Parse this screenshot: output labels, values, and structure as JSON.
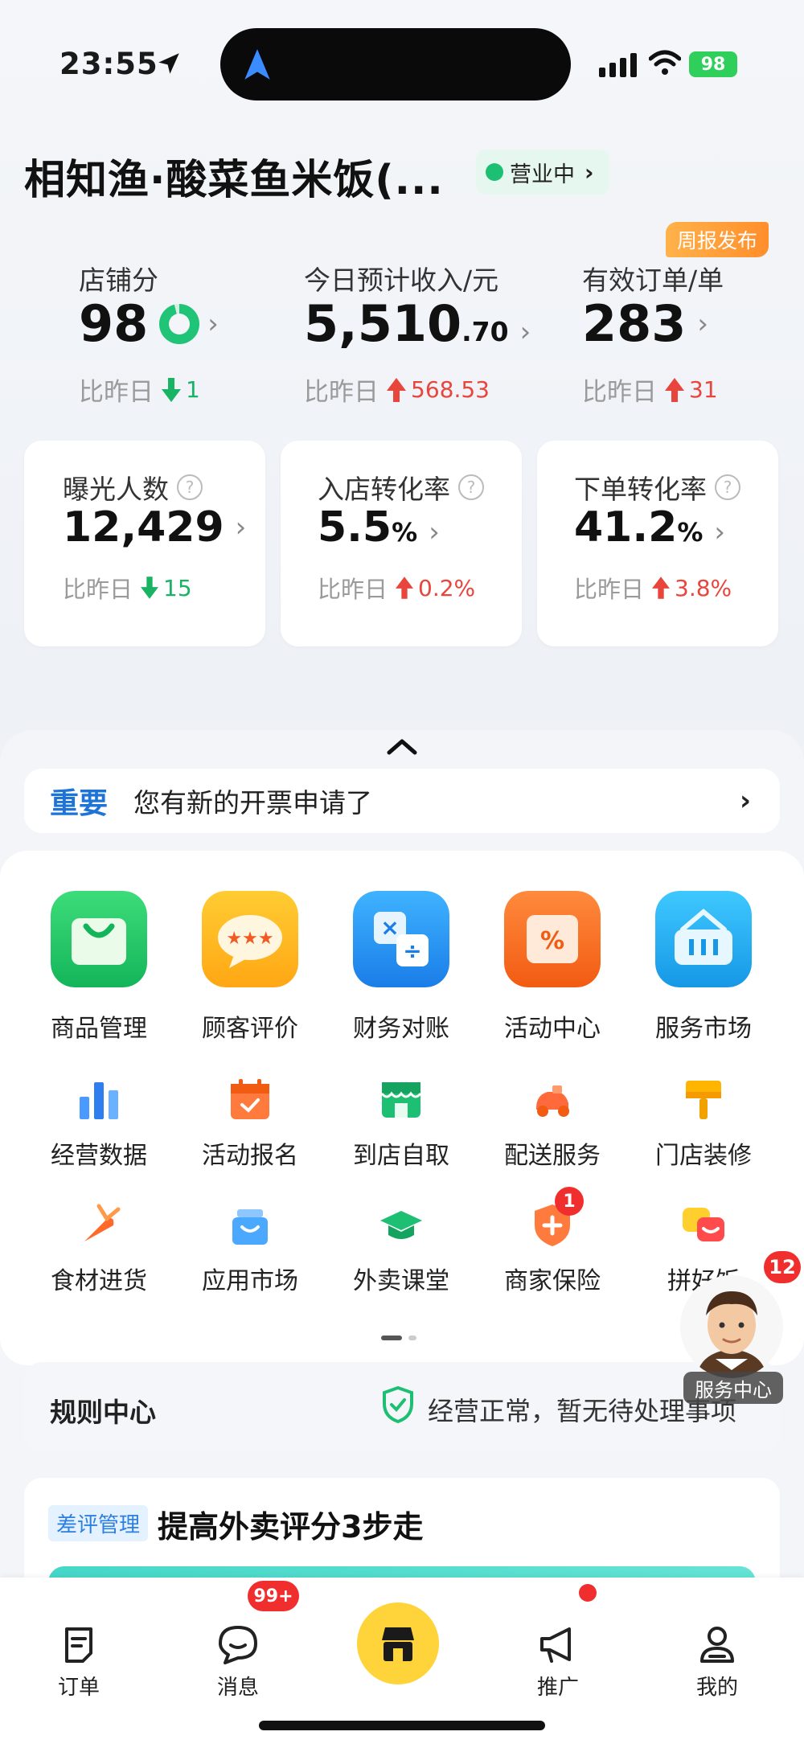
{
  "status_bar": {
    "time": "23:55",
    "battery": "98"
  },
  "header": {
    "store_name": "相知渔·酸菜鱼米饭(...",
    "status": "营业中",
    "weekly_report": "周报发布"
  },
  "kpis": [
    {
      "label": "店铺分",
      "value": "98",
      "decimal": "",
      "compare_label": "比昨日",
      "delta": "1",
      "direction": "down"
    },
    {
      "label": "今日预计收入/元",
      "value": "5,510",
      "decimal": ".70",
      "compare_label": "比昨日",
      "delta": "568.53",
      "direction": "up"
    },
    {
      "label": "有效订单/单",
      "value": "283",
      "decimal": "",
      "compare_label": "比昨日",
      "delta": "31",
      "direction": "up"
    }
  ],
  "metrics": [
    {
      "label": "曝光人数",
      "value": "12,429",
      "unit": "",
      "compare_label": "比昨日",
      "delta": "15",
      "direction": "down"
    },
    {
      "label": "入店转化率",
      "value": "5.5",
      "unit": "%",
      "compare_label": "比昨日",
      "delta": "0.2%",
      "direction": "up"
    },
    {
      "label": "下单转化率",
      "value": "41.2",
      "unit": "%",
      "compare_label": "比昨日",
      "delta": "3.8%",
      "direction": "up"
    }
  ],
  "notice": {
    "tag": "重要",
    "message": "您有新的开票申请了"
  },
  "apps_row1": [
    "商品管理",
    "顾客评价",
    "财务对账",
    "活动中心",
    "服务市场"
  ],
  "apps_row2": [
    "经营数据",
    "活动报名",
    "到店自取",
    "配送服务",
    "门店装修"
  ],
  "apps_row3": [
    "食材进货",
    "应用市场",
    "外卖课堂",
    "商家保险",
    "拼好饭"
  ],
  "app_badges": {
    "insurance": "1",
    "avatar": "12"
  },
  "rules": {
    "title": "规则中心",
    "status": "经营正常，暂无待处理事项"
  },
  "tip": {
    "tag": "差评管理",
    "title": "提高外卖评分3步走"
  },
  "avatar_label": "服务中心",
  "tabbar": {
    "orders": "订单",
    "messages": "消息",
    "messages_badge": "99+",
    "promote": "推广",
    "mine": "我的"
  },
  "colors": {
    "accent_blue": "#1e74d6",
    "up_red": "#e8453c",
    "down_green": "#19b364",
    "brand_yellow": "#ffd33a"
  }
}
